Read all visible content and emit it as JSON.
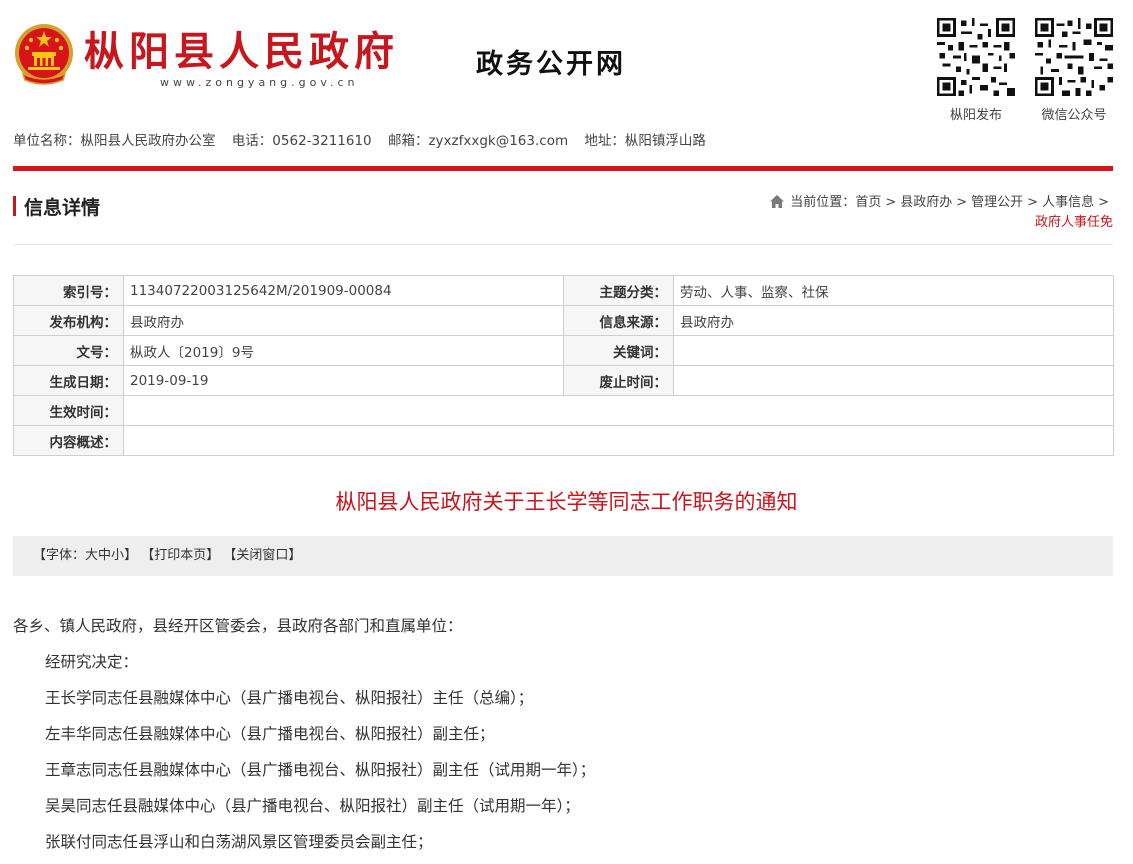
{
  "header": {
    "site_name": "枞阳县人民政府",
    "site_url": "www.zongyang.gov.cn",
    "site_sub": "政务公开网",
    "qr_codes": [
      {
        "label": "枞阳发布",
        "icon": "qr-code-icon"
      },
      {
        "label": "微信公众号",
        "icon": "qr-code-icon"
      }
    ]
  },
  "unit_info": {
    "unit": "单位名称：枞阳县人民政府办公室",
    "phone": "电话：0562-3211610",
    "email": "邮箱：zyxzfxxgk@163.com",
    "address": "地址：枞阳镇浮山路"
  },
  "section": {
    "title": "信息详情",
    "breadcrumb_prefix": "当前位置：",
    "breadcrumb": [
      "首页",
      "县政府办",
      "管理公开",
      "人事信息"
    ],
    "current": "政府人事任免"
  },
  "meta": {
    "index_no_label": "索引号：",
    "index_no": "11340722003125642M/201909-00084",
    "topic_label": "主题分类：",
    "topic": "劳动、人事、监察、社保",
    "publisher_label": "发布机构：",
    "publisher": "县政府办",
    "source_label": "信息来源：",
    "source": "县政府办",
    "doc_no_label": "文号：",
    "doc_no": "枞政人〔2019〕9号",
    "keywords_label": "关键词：",
    "keywords": "",
    "created_label": "生成日期：",
    "created": "2019-09-19",
    "expired_label": "废止时间：",
    "expired": "",
    "effective_label": "生效时间：",
    "effective": "",
    "summary_label": "内容概述：",
    "summary": ""
  },
  "article": {
    "title": "枞阳县人民政府关于王长学等同志工作职务的通知",
    "tools": {
      "font_prefix": "【字体：",
      "font_large": "大",
      "font_medium": "中",
      "font_small": "小",
      "font_suffix": "】",
      "print": "【打印本页】",
      "close": "【关闭窗口】"
    },
    "paragraphs": [
      "各乡、镇人民政府，县经开区管委会，县政府各部门和直属单位：",
      "经研究决定：",
      "王长学同志任县融媒体中心（县广播电视台、枞阳报社）主任（总编）；",
      "左丰华同志任县融媒体中心（县广播电视台、枞阳报社）副主任；",
      "王章志同志任县融媒体中心（县广播电视台、枞阳报社）副主任（试用期一年）；",
      "吴昊同志任县融媒体中心（县广播电视台、枞阳报社）副主任（试用期一年）；",
      "张联付同志任县浮山和白荡湖风景区管理委员会副主任；"
    ]
  },
  "colors": {
    "brand_red": "#c8161d",
    "bar_red": "#d7141a",
    "toolbar_bg": "#eeeeee"
  }
}
